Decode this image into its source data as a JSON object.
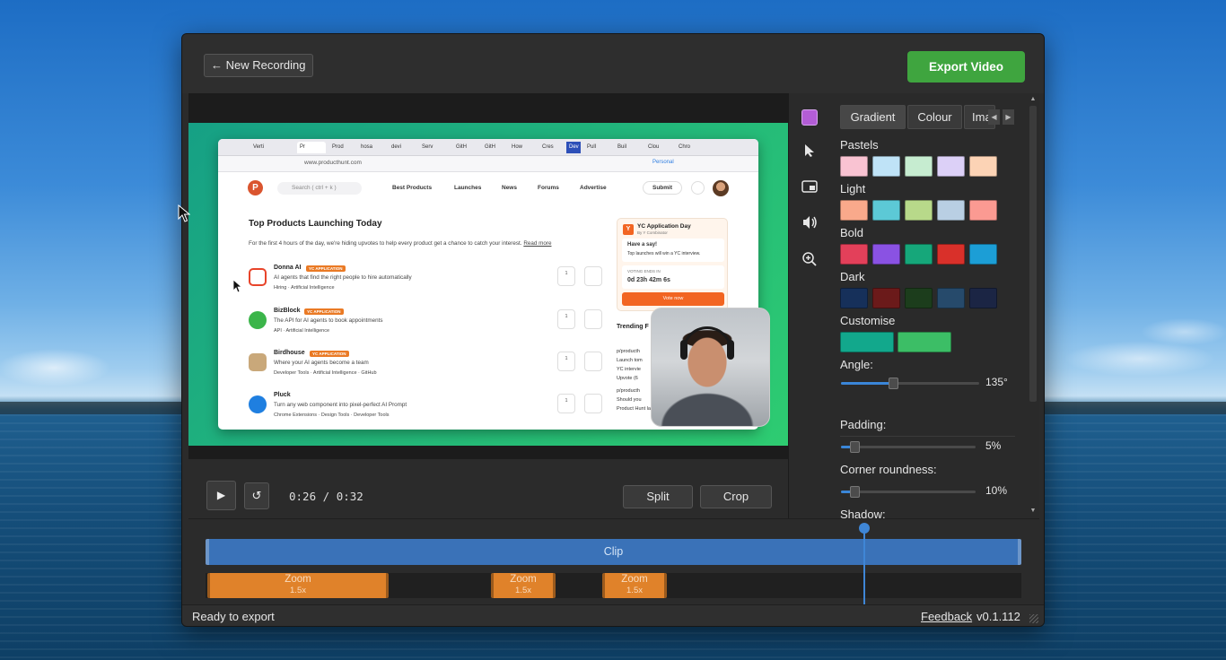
{
  "header": {
    "new_recording": "← New Recording",
    "export_video": "Export Video"
  },
  "preview": {
    "browser_tabs": [
      "Verti",
      "Pr",
      "Prod",
      "hosa",
      "devi",
      "Serv",
      "GitH",
      "GitH",
      "How",
      "Cres",
      "Dev",
      "Pull",
      "Buil",
      "Clou",
      "Chro"
    ],
    "url": "www.producthunt.com",
    "personal": "Personal",
    "search_placeholder": "Search ( ctrl + k )",
    "nav": [
      "Best Products",
      "Launches",
      "News",
      "Forums",
      "Advertise"
    ],
    "submit": "Submit",
    "logo_letter": "P",
    "heading": "Top Products Launching Today",
    "subheading": "For the first 4 hours of the day, we're hiding upvotes to help every product get a chance to catch your interest.",
    "read_more": "Read more",
    "products": [
      {
        "name": "Donna AI",
        "badge": "YC APPLICATION",
        "desc": "AI agents that find the right people to hire automatically",
        "tags": "Hiring · Artificial Intelligence",
        "comments": "1",
        "color": "#e8442a"
      },
      {
        "name": "BizBlock",
        "badge": "YC APPLICATION",
        "desc": "The API for AI agents to book appointments",
        "tags": "API · Artificial Intelligence",
        "comments": "1",
        "color": "#3bb54a"
      },
      {
        "name": "Birdhouse",
        "badge": "YC APPLICATION",
        "desc": "Where your AI agents become a team",
        "tags": "Developer Tools · Artificial Intelligence · GitHub",
        "comments": "1",
        "color": "#b08a5a"
      },
      {
        "name": "Pluck",
        "badge": "",
        "desc": "Turn any web component into pixel-perfect AI Prompt",
        "tags": "Chrome Extensions · Design Tools · Developer Tools",
        "comments": "1",
        "color": "#1f7fe0"
      }
    ],
    "yc": {
      "title": "YC Application Day",
      "by": "By Y Combinator",
      "box1_title": "Have a say!",
      "box1_text": "Top launches will win a YC interview.",
      "box2_title": "VOTING ENDS IN",
      "box2_text": "0d 23h 42m 6s",
      "vote": "Vote now"
    },
    "trending": "Trending F",
    "trending_items": [
      "p/producth",
      "Launch tom",
      "YC intervie",
      "Upvote (6",
      "p/producth",
      "Should you",
      "Product Hunt launch"
    ]
  },
  "transport": {
    "play_icon": "▶",
    "reset_icon": "↺",
    "current": "0:26",
    "separator": "/",
    "total": "0:32",
    "split": "Split",
    "crop": "Crop"
  },
  "side": {
    "tabs": [
      "Gradient",
      "Colour",
      "Ima"
    ],
    "sections": {
      "pastels": "Pastels",
      "light": "Light",
      "bold": "Bold",
      "dark": "Dark",
      "customise": "Customise",
      "angle": "Angle:",
      "padding": "Padding:",
      "corner": "Corner roundness:",
      "shadow": "Shadow:"
    },
    "pastels": [
      "#f9c3d2",
      "#bfe3f7",
      "#c6ecd0",
      "#dcd0f7",
      "#fcd3b5"
    ],
    "light": [
      "#f9a98b",
      "#5cc9d6",
      "#b8d98a",
      "#b9cfe3",
      "#fb9a92"
    ],
    "bold": [
      "#e3405a",
      "#8a52e3",
      "#16a77a",
      "#d9302a",
      "#1c9ed6"
    ],
    "dark": [
      "#16305a",
      "#6b1a1a",
      "#1c3d1c",
      "#264a6b",
      "#1b2544"
    ],
    "customise": [
      "#12a88c",
      "#3cbe66"
    ],
    "angle_value": "135°",
    "angle_fraction": 0.375,
    "padding_value": "5%",
    "padding_fraction": 0.1,
    "corner_value": "10%",
    "corner_fraction": 0.1
  },
  "timeline": {
    "clip": "Clip",
    "zooms": [
      {
        "label": "Zoom",
        "value": "1.5x"
      },
      {
        "label": "Zoom",
        "value": "1.5x"
      },
      {
        "label": "Zoom",
        "value": "1.5x"
      }
    ]
  },
  "status": {
    "text": "Ready to export",
    "feedback": "Feedback",
    "version": "v0.1.112"
  },
  "colors": {
    "accent_green": "#3fa53f",
    "clip_blue": "#3a72b8",
    "zoom_orange": "#e0822a",
    "gradient_start": "#16a085",
    "gradient_end": "#2ecc71"
  }
}
